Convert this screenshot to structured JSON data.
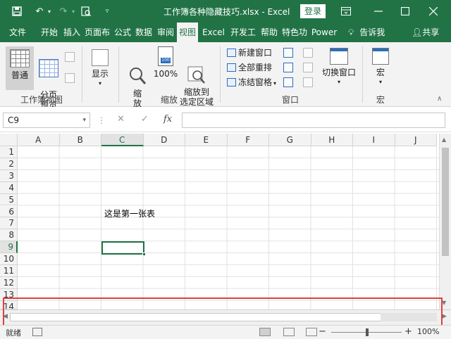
{
  "title": {
    "doc_name": "工作簿各种隐藏技巧.xlsx  -  Excel",
    "login": "登录"
  },
  "tabs": [
    "文件",
    "开始",
    "插入",
    "页面布",
    "公式",
    "数据",
    "审阅",
    "视图",
    "Excel",
    "开发工",
    "帮助",
    "特色功",
    "Power"
  ],
  "active_tab": "视图",
  "tell_me": "告诉我",
  "share": "共享",
  "ribbon": {
    "workbook_views": {
      "group_label": "工作簿视图",
      "normal": "普通",
      "page_break": "分页\n预览"
    },
    "show": {
      "label": "显示"
    },
    "zoom": {
      "group_label": "缩放",
      "zoom": "缩\n放",
      "zoom100": "100%",
      "zoom_selection": "缩放到\n选定区域"
    },
    "window": {
      "group_label": "窗口",
      "new_window": "新建窗口",
      "arrange_all": "全部重排",
      "freeze_panes": "冻结窗格",
      "switch_windows": "切换窗口"
    },
    "macros": {
      "group_label": "宏",
      "macros": "宏"
    }
  },
  "formula_bar": {
    "name_box": "C9",
    "fx": "fx",
    "content": ""
  },
  "columns": [
    "A",
    "B",
    "C",
    "D",
    "E",
    "F",
    "G",
    "H",
    "I",
    "J"
  ],
  "active_column": "C",
  "rows": [
    "1",
    "2",
    "3",
    "4",
    "5",
    "6",
    "7",
    "8",
    "9",
    "10",
    "11",
    "12",
    "13",
    "14"
  ],
  "active_row": "9",
  "cells": {
    "C6": "这是第一张表"
  },
  "status": {
    "ready": "就绪",
    "zoom": "100%",
    "zoom_percent": 100
  }
}
